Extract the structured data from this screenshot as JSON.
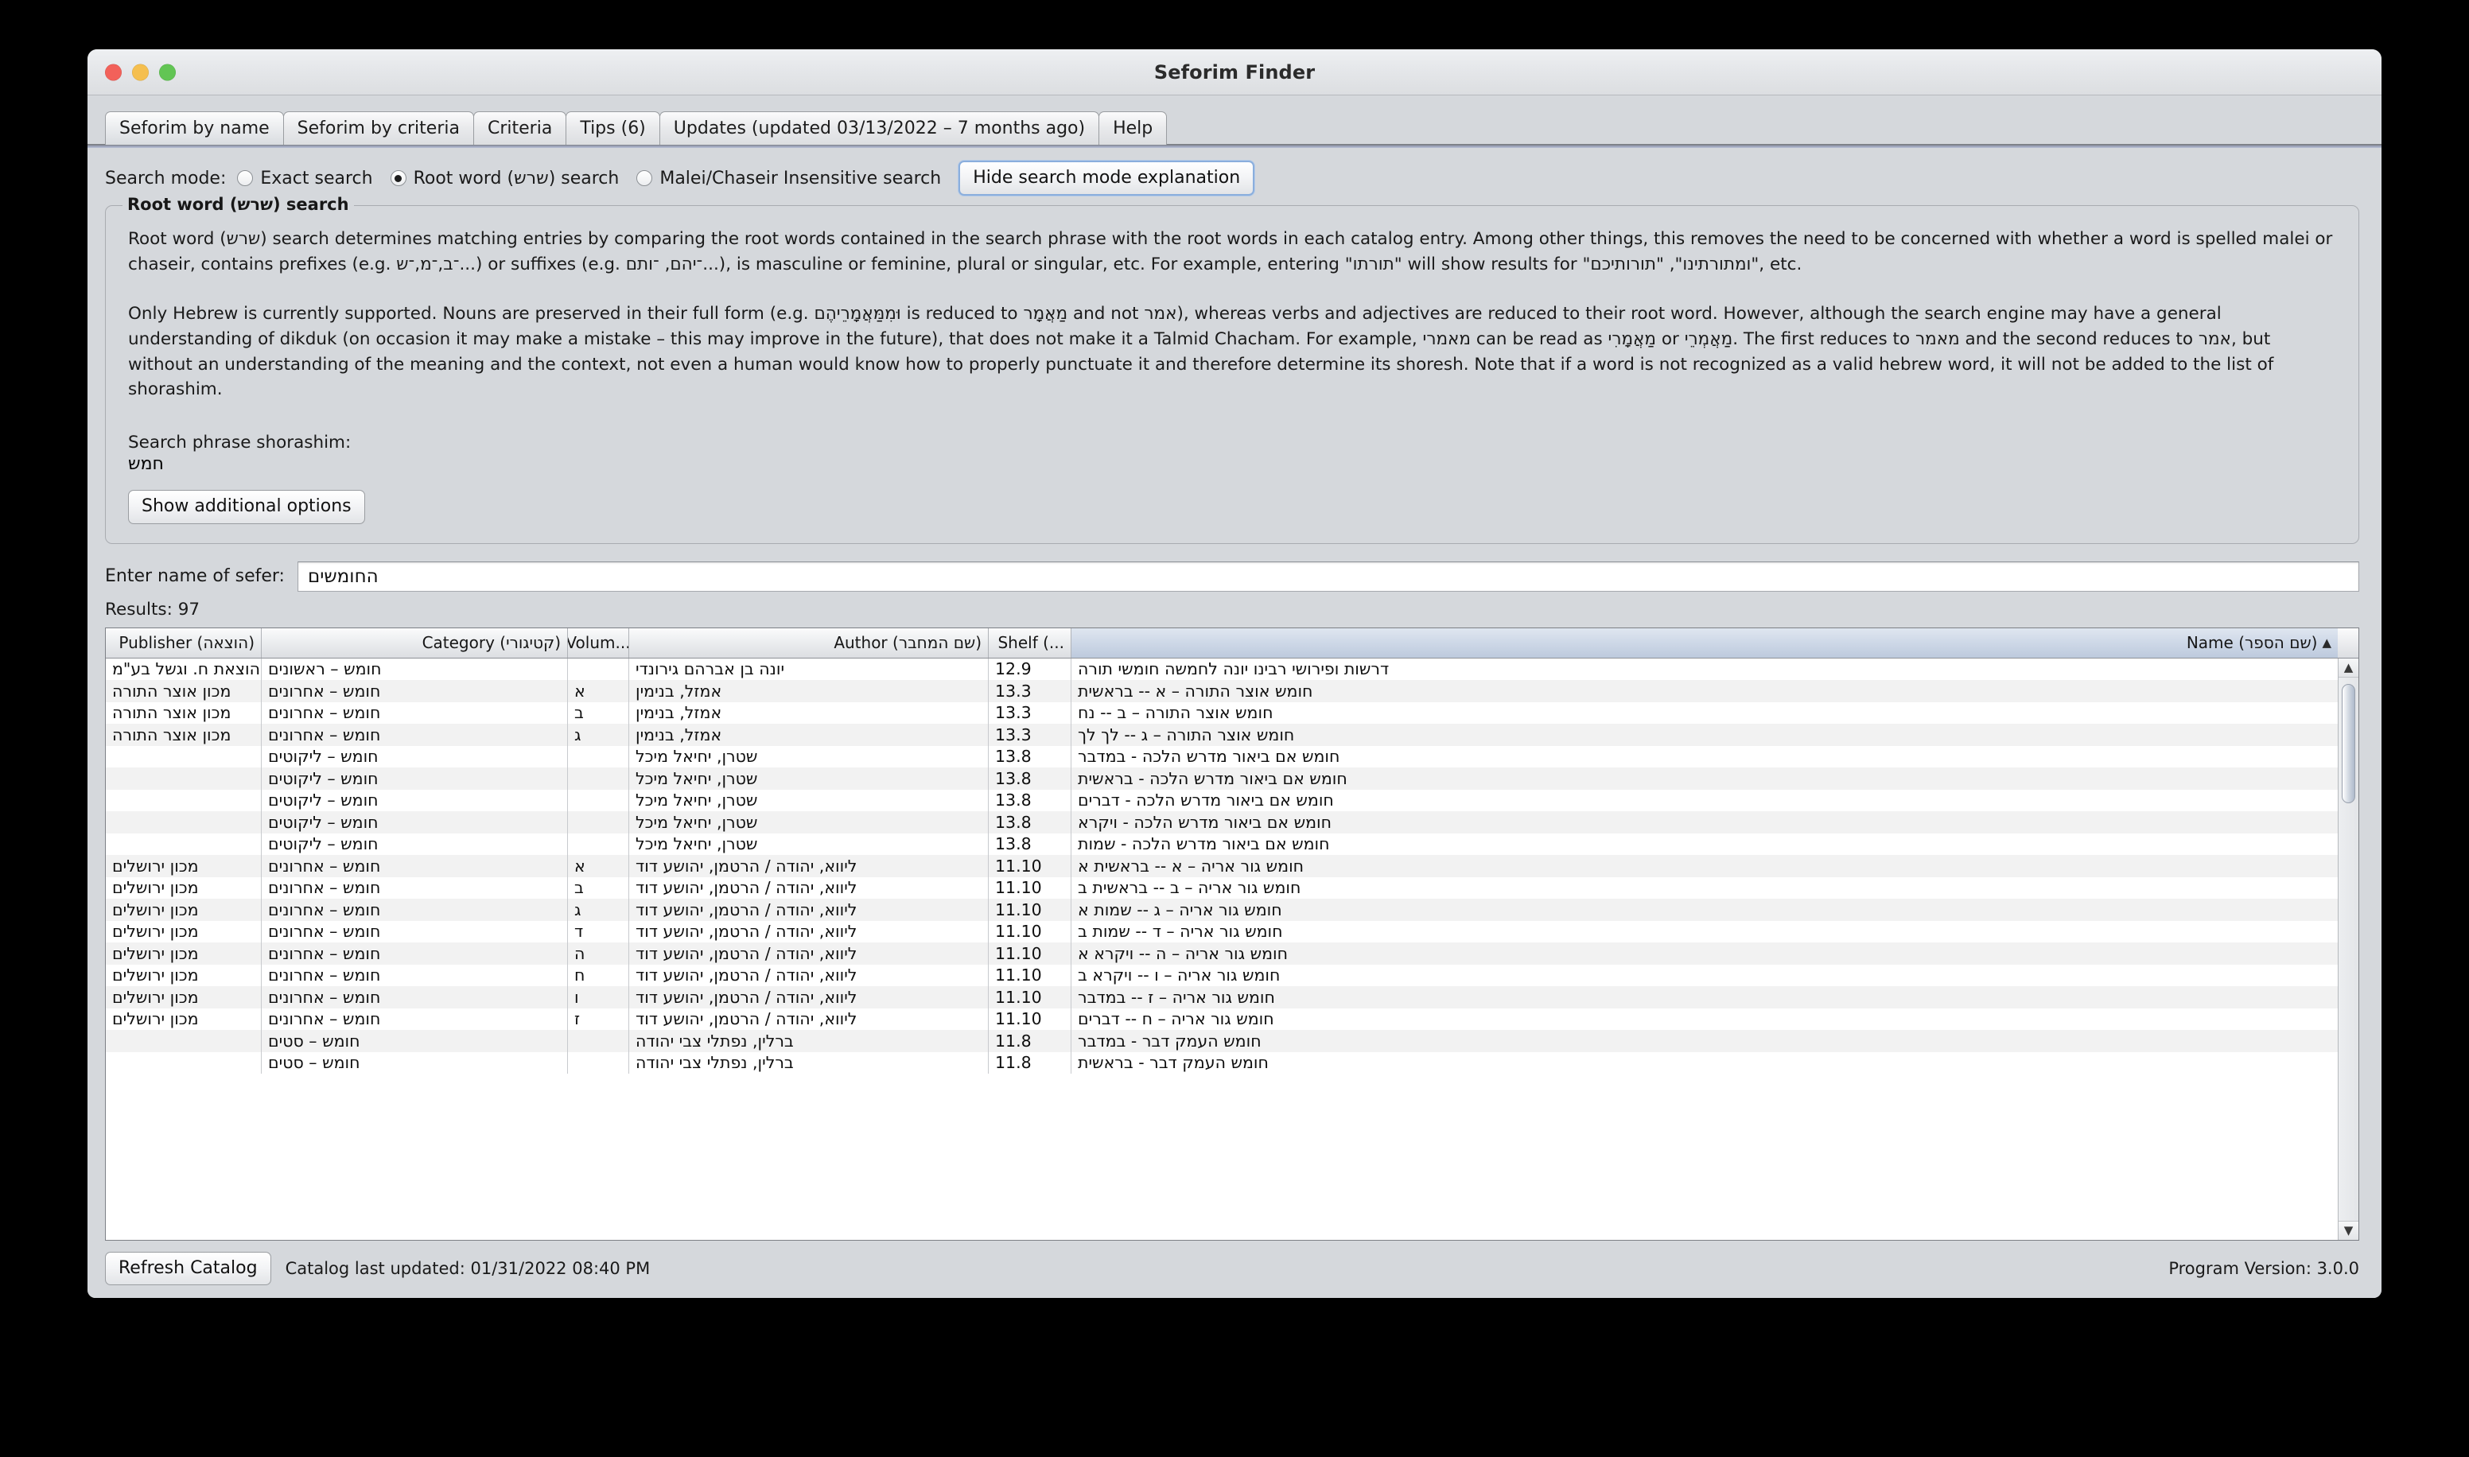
{
  "window": {
    "title": "Seforim Finder",
    "traffic_lights": [
      "close",
      "minimize",
      "zoom"
    ]
  },
  "tabs": [
    {
      "label": "Seforim by name",
      "active": true
    },
    {
      "label": "Seforim by criteria",
      "active": false
    },
    {
      "label": "Criteria",
      "active": false
    },
    {
      "label": "Tips (6)",
      "active": false
    },
    {
      "label": "Updates (updated 03/13/2022 – 7 months ago)",
      "active": false
    },
    {
      "label": "Help",
      "active": false
    }
  ],
  "search_mode": {
    "label": "Search mode:",
    "options": [
      {
        "label": "Exact search",
        "selected": false
      },
      {
        "label": "Root word (שרש) search",
        "selected": true
      },
      {
        "label": "Malei/Chaseir Insensitive search",
        "selected": false
      }
    ],
    "toggle_button": "Hide search mode explanation"
  },
  "explanation": {
    "legend": "Root word (שרש) search",
    "paragraph1": "Root word (שרש) search determines matching entries by comparing the root words contained in the search phrase with the root words in each catalog entry. Among other things, this removes the need to be concerned with whether a word is spelled malei or chaseir, contains prefixes (e.g. ־ב,־מ,־ש...) or suffixes (e.g. ־יהם, ־ותם...), is masculine or feminine, plural or singular, etc. For example, entering \"תורתו\" will show results for \"ומתורתינו\", \"תורותיכם\", etc.",
    "paragraph2": "Only Hebrew is currently supported. Nouns are preserved in their full form (e.g. וּמִמַּאֲמָרֵיהֶם is reduced to מַאֲמָר and not אמר), whereas verbs and adjectives are reduced to their root word. However, although the search engine may have a general understanding of dikduk (on occasion it may make a mistake – this may improve in the future), that does not make it a Talmid Chacham. For example, מאמרי can be read as מַאֲמָרִי or מַאֲמְרֵי. The first reduces to מאמר and the second reduces to אמר, but without an understanding of the meaning and the context, not even a human would know how to properly punctuate it and therefore determine its shoresh. Note that if a word is not recognized as a valid hebrew word, it will not be added to the list of shorashim.",
    "shorashim_label": "Search phrase shorashim:",
    "shorashim_value": "חמש",
    "additional_options_button": "Show additional options"
  },
  "search": {
    "field_label": "Enter name of sefer:",
    "field_value": "החומשים",
    "placeholder": "",
    "results_label": "Results: 97"
  },
  "table": {
    "columns": [
      {
        "key": "publisher",
        "label": "Publisher (הוצאה)",
        "sorted": false
      },
      {
        "key": "category",
        "label": "Category (קטיגורי)",
        "sorted": false
      },
      {
        "key": "volume",
        "label": "Volum...",
        "sorted": false
      },
      {
        "key": "author",
        "label": "Author (שם המחבר)",
        "sorted": false
      },
      {
        "key": "shelf",
        "label": "Shelf (...",
        "sorted": false
      },
      {
        "key": "name",
        "label": "Name (שם הספר)",
        "sorted": true,
        "sort_arrow": "▲"
      }
    ],
    "rows": [
      {
        "publisher": "הוצאת ח. וגשל בע\"מ",
        "category": "חומש – ראשונים",
        "volume": "",
        "author": "יונה בן אברהם גירונדי",
        "shelf": "12.9",
        "name": "דרשות ופירושי רבינו יונה לחמשה חומשי תורה"
      },
      {
        "publisher": "מכון אוצר התורה",
        "category": "חומש – אחרונים",
        "volume": "א",
        "author": "אמזל, בנימין",
        "shelf": "13.3",
        "name": "חומש אוצר התורה – א -- בראשית"
      },
      {
        "publisher": "מכון אוצר התורה",
        "category": "חומש – אחרונים",
        "volume": "ב",
        "author": "אמזל, בנימין",
        "shelf": "13.3",
        "name": "חומש אוצר התורה – ב -- נח"
      },
      {
        "publisher": "מכון אוצר התורה",
        "category": "חומש – אחרונים",
        "volume": "ג",
        "author": "אמזל, בנימין",
        "shelf": "13.3",
        "name": "חומש אוצר התורה – ג -- לך לך"
      },
      {
        "publisher": "",
        "category": "חומש – ליקוטים",
        "volume": "",
        "author": "שטרן, יחיאל מיכל",
        "shelf": "13.8",
        "name": "חומש אם ביאור מדרש הלכה - במדבר"
      },
      {
        "publisher": "",
        "category": "חומש – ליקוטים",
        "volume": "",
        "author": "שטרן, יחיאל מיכל",
        "shelf": "13.8",
        "name": "חומש אם ביאור מדרש הלכה - בראשית"
      },
      {
        "publisher": "",
        "category": "חומש – ליקוטים",
        "volume": "",
        "author": "שטרן, יחיאל מיכל",
        "shelf": "13.8",
        "name": "חומש אם ביאור מדרש הלכה - דברים"
      },
      {
        "publisher": "",
        "category": "חומש – ליקוטים",
        "volume": "",
        "author": "שטרן, יחיאל מיכל",
        "shelf": "13.8",
        "name": "חומש אם ביאור מדרש הלכה - ויקרא"
      },
      {
        "publisher": "",
        "category": "חומש – ליקוטים",
        "volume": "",
        "author": "שטרן, יחיאל מיכל",
        "shelf": "13.8",
        "name": "חומש אם ביאור מדרש הלכה - שמות"
      },
      {
        "publisher": "מכון ירושלים",
        "category": "חומש – אחרונים",
        "volume": "א",
        "author": "ליווא, יהודה / הרטמן, יהושע דוד",
        "shelf": "11.10",
        "name": "חומש גור אריה – א -- בראשית א"
      },
      {
        "publisher": "מכון ירושלים",
        "category": "חומש – אחרונים",
        "volume": "ב",
        "author": "ליווא, יהודה / הרטמן, יהושע דוד",
        "shelf": "11.10",
        "name": "חומש גור אריה – ב -- בראשית ב"
      },
      {
        "publisher": "מכון ירושלים",
        "category": "חומש – אחרונים",
        "volume": "ג",
        "author": "ליווא, יהודה / הרטמן, יהושע דוד",
        "shelf": "11.10",
        "name": "חומש גור אריה – ג -- שמות א"
      },
      {
        "publisher": "מכון ירושלים",
        "category": "חומש – אחרונים",
        "volume": "ד",
        "author": "ליווא, יהודה / הרטמן, יהושע דוד",
        "shelf": "11.10",
        "name": "חומש גור אריה – ד -- שמות ב"
      },
      {
        "publisher": "מכון ירושלים",
        "category": "חומש – אחרונים",
        "volume": "ה",
        "author": "ליווא, יהודה / הרטמן, יהושע דוד",
        "shelf": "11.10",
        "name": "חומש גור אריה – ה -- ויקרא א"
      },
      {
        "publisher": "מכון ירושלים",
        "category": "חומש – אחרונים",
        "volume": "ח",
        "author": "ליווא, יהודה / הרטמן, יהושע דוד",
        "shelf": "11.10",
        "name": "חומש גור אריה – ו -- ויקרא ב"
      },
      {
        "publisher": "מכון ירושלים",
        "category": "חומש – אחרונים",
        "volume": "ו",
        "author": "ליווא, יהודה / הרטמן, יהושע דוד",
        "shelf": "11.10",
        "name": "חומש גור אריה – ז -- במדבר"
      },
      {
        "publisher": "מכון ירושלים",
        "category": "חומש – אחרונים",
        "volume": "ז",
        "author": "ליווא, יהודה / הרטמן, יהושע דוד",
        "shelf": "11.10",
        "name": "חומש גור אריה – ח -- דברים"
      },
      {
        "publisher": "",
        "category": "חומש – סטים",
        "volume": "",
        "author": "ברלין, נפתלי צבי יהודה",
        "shelf": "11.8",
        "name": "חומש העמק דבר - במדבר"
      },
      {
        "publisher": "",
        "category": "חומש – סטים",
        "volume": "",
        "author": "ברלין, נפתלי צבי יהודה",
        "shelf": "11.8",
        "name": "חומש העמק דבר - בראשית"
      }
    ]
  },
  "statusbar": {
    "refresh_button": "Refresh Catalog",
    "catalog_updated": "Catalog last updated: 01/31/2022 08:40 PM",
    "program_version": "Program Version: 3.0.0"
  },
  "icons": {
    "scroll_up": "▲",
    "scroll_down": "▼"
  }
}
